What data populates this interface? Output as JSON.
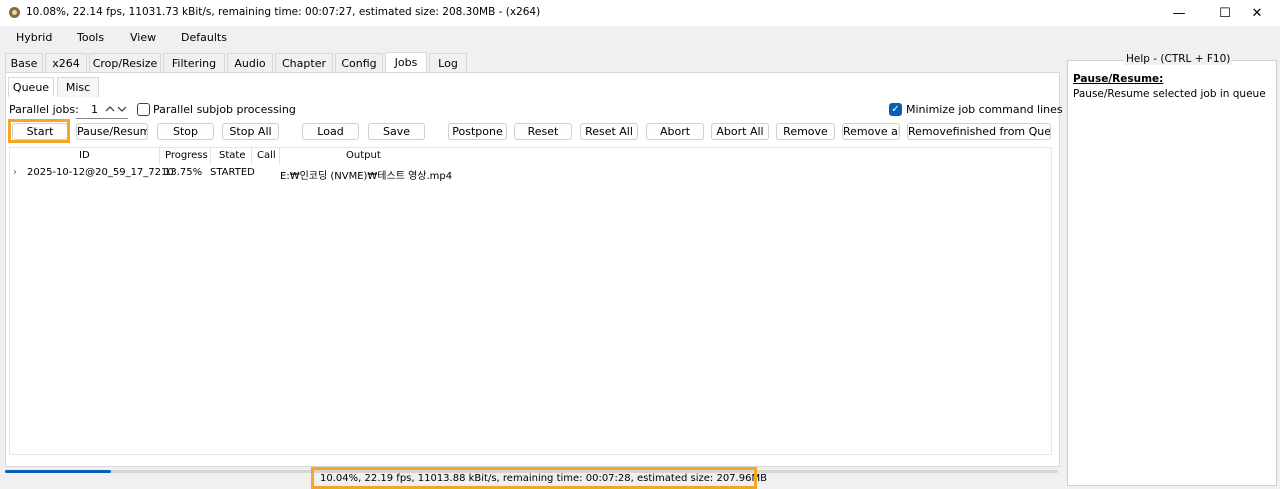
{
  "window": {
    "title": "10.08%, 22.14 fps, 11031.73 kBit/s, remaining time: 00:07:27, estimated size: 208.30MB - (x264)",
    "minimize": "—",
    "maximize": "☐",
    "close": "✕"
  },
  "menu": [
    "Hybrid",
    "Tools",
    "View",
    "Defaults"
  ],
  "tabs": [
    "Base",
    "x264",
    "Crop/Resize",
    "Filtering",
    "Audio",
    "Chapter",
    "Config",
    "Jobs",
    "Log"
  ],
  "active_tab": "Jobs",
  "subtabs": [
    "Queue",
    "Misc"
  ],
  "parallel": {
    "label": "Parallel jobs:",
    "value": "1",
    "subjob_label": "Parallel subjob processing",
    "minimize_label": "Minimize job command lines"
  },
  "buttons": [
    "Start",
    "Pause/Resume",
    "Stop",
    "Stop All",
    "Load",
    "Save",
    "Postpone",
    "Reset",
    "Reset All",
    "Abort",
    "Abort All",
    "Remove",
    "Remove all",
    "Removefinished from Queue"
  ],
  "columns": [
    "ID",
    "Progress",
    "State",
    "Call",
    "Output"
  ],
  "jobs": [
    {
      "expander": "›",
      "id": "2025-10-12@20_59_17_7210",
      "progress": "13.75%",
      "state": "STARTED",
      "call": "",
      "output": "E:₩인코딩 (NVME)₩테스트 영상.mp4"
    }
  ],
  "status": {
    "text": "10.04%, 22.19 fps, 11013.88 kBit/s, remaining time: 00:07:28, estimated size: 207.96MB",
    "progress_fraction": 0.1004
  },
  "help": {
    "legend": "Help - (CTRL + F10)",
    "heading": "Pause/Resume:",
    "body": "Pause/Resume selected job in queue"
  },
  "colors": {
    "accent": "#0a5fb4",
    "highlight": "#f5a623"
  }
}
